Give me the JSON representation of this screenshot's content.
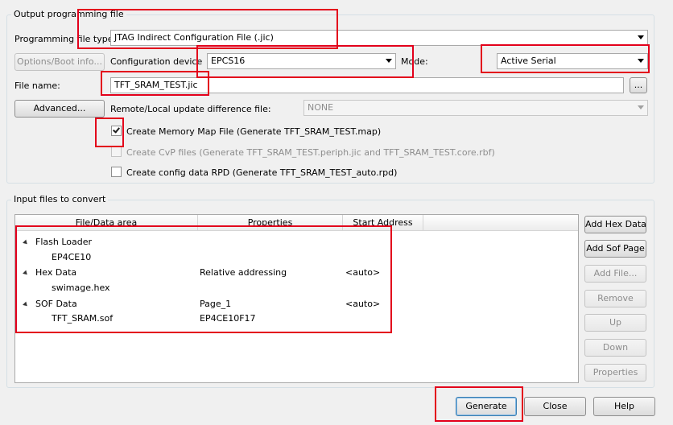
{
  "output_group": {
    "title": "Output programming file",
    "programming_file_type_label": "Programming file type:",
    "programming_file_type_value": "JTAG Indirect Configuration File (.jic)",
    "options_boot_button": "Options/Boot info...",
    "configuration_device_label": "Configuration device",
    "configuration_device_value": "EPCS16",
    "mode_label": "Mode:",
    "mode_value": "Active Serial",
    "file_name_label": "File name:",
    "file_name_value": "TFT_SRAM_TEST.jic",
    "browse_button": "...",
    "advanced_button": "Advanced...",
    "remote_local_label": "Remote/Local update difference file:",
    "remote_local_value": "NONE",
    "create_memory_map": {
      "label": "Create Memory Map File (Generate TFT_SRAM_TEST.map)",
      "checked": true,
      "enabled": true
    },
    "create_cvp": {
      "label": "Create CvP files (Generate TFT_SRAM_TEST.periph.jic and TFT_SRAM_TEST.core.rbf)",
      "checked": false,
      "enabled": false
    },
    "create_rpd": {
      "label": "Create config data RPD (Generate TFT_SRAM_TEST_auto.rpd)",
      "checked": false,
      "enabled": true
    }
  },
  "input_group": {
    "title": "Input files to convert",
    "columns": [
      "File/Data area",
      "Properties",
      "Start Address"
    ],
    "rows": [
      {
        "name": "Flash Loader",
        "properties": "",
        "start": "",
        "level": 0
      },
      {
        "name": "EP4CE10",
        "properties": "",
        "start": "",
        "level": 1
      },
      {
        "name": "Hex Data",
        "properties": "Relative addressing",
        "start": "<auto>",
        "level": 0
      },
      {
        "name": "swimage.hex",
        "properties": "",
        "start": "",
        "level": 1
      },
      {
        "name": "SOF Data",
        "properties": "Page_1",
        "start": "<auto>",
        "level": 0
      },
      {
        "name": "TFT_SRAM.sof",
        "properties": "EP4CE10F17",
        "start": "",
        "level": 1
      }
    ],
    "side_buttons": {
      "add_hex_data": "Add Hex Data",
      "add_sof_page": "Add Sof Page",
      "add_file": "Add File...",
      "remove": "Remove",
      "up": "Up",
      "down": "Down",
      "properties": "Properties"
    }
  },
  "footer": {
    "generate": "Generate",
    "close": "Close",
    "help": "Help"
  },
  "colors": {
    "highlight_box": "#e3001b"
  }
}
